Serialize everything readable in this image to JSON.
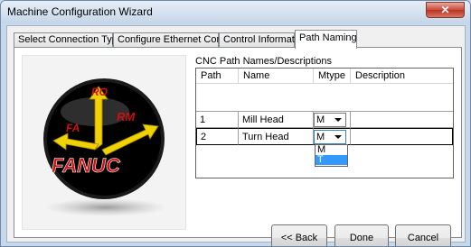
{
  "window": {
    "title": "Machine Configuration Wizard",
    "close_glyph": "✕"
  },
  "tabs": [
    {
      "label": "Select Connection Type",
      "active": false
    },
    {
      "label": "Configure Ethernet Control",
      "active": false
    },
    {
      "label": "Control Information",
      "active": false
    },
    {
      "label": "Path Naming",
      "active": true
    }
  ],
  "logo": {
    "brand": "FANUC",
    "arrow_labels": {
      "top": "RO",
      "left": "FA",
      "right": "RM"
    },
    "colors": {
      "disc": "#cc1111",
      "arrows": "#f1d100",
      "text": "#cc1111",
      "brand_text": "#ffffff"
    }
  },
  "grid": {
    "caption": "CNC Path Names/Descriptions",
    "columns": [
      "Path",
      "Name",
      "Mtype",
      "Description"
    ],
    "rows": [
      {
        "path": "1",
        "name": "Mill Head",
        "mtype": "M",
        "description": ""
      },
      {
        "path": "2",
        "name": "Turn Head",
        "mtype": "M",
        "description": ""
      }
    ],
    "dropdown_options": [
      "M",
      "T"
    ],
    "dropdown_highlighted": "T"
  },
  "buttons": {
    "back": "<< Back",
    "done": "Done",
    "cancel": "Cancel"
  }
}
